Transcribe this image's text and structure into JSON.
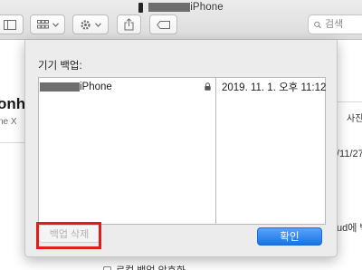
{
  "window": {
    "title": "iPhone"
  },
  "toolbar": {
    "buttons": [
      {
        "name": "sidebar-toggle",
        "icon": "sidebar-icon"
      },
      {
        "name": "view-options",
        "icon": "grid-view-icon"
      },
      {
        "name": "action-menu",
        "icon": "gear-icon"
      },
      {
        "name": "share",
        "icon": "share-icon"
      },
      {
        "name": "tag",
        "icon": "tag-icon"
      }
    ],
    "search": {
      "placeholder": "검색",
      "value": ""
    }
  },
  "background": {
    "device_name": "onhe",
    "device_model": "ne X",
    "tab_label": "사진",
    "date_text": "/11/27",
    "icloud_text": "ud에 백",
    "bottom_checkbox_label": "로컬 백업 암호화"
  },
  "sheet": {
    "title": "기기 백업:",
    "backups": [
      {
        "name": "iPhone",
        "locked": true,
        "date": "2019. 11. 1. 오후 11:12"
      }
    ],
    "delete_label": "백업 삭제",
    "confirm_label": "확인"
  },
  "colors": {
    "accent": "#1773e8",
    "highlight": "#e01c1c",
    "sheet_bg": "#ececec"
  }
}
